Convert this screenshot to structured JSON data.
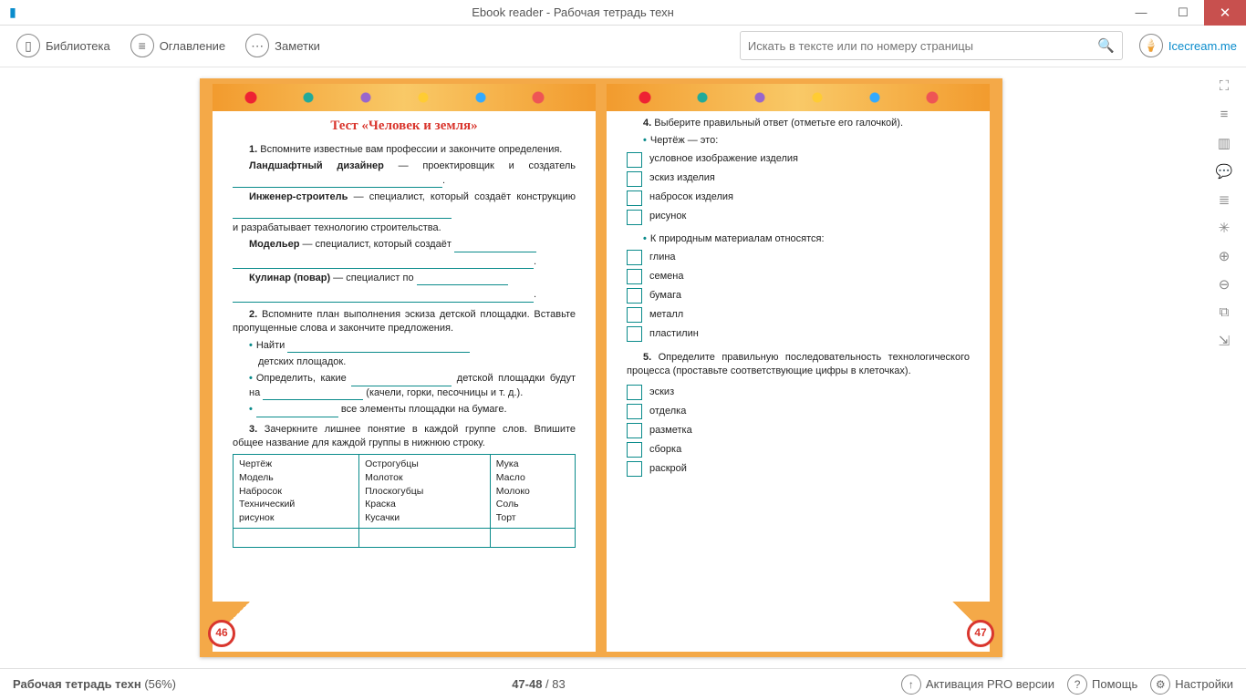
{
  "titlebar": {
    "title": "Ebook reader - Рабочая тетрадь техн"
  },
  "toolbar": {
    "library": "Библиотека",
    "toc": "Оглавление",
    "notes": "Заметки",
    "search_placeholder": "Искать в тексте или по номеру страницы",
    "brand": "Icecream.me"
  },
  "left": {
    "num": "46",
    "title": "Тест «Человек и земля»",
    "q1_a": "1.",
    "q1_b": " Вспомните известные вам профессии и закончите определения.",
    "q1_l1a": "Ландшафтный дизайнер",
    "q1_l1b": " — проектировщик и созда­тель ",
    "q1_l2a": "Инженер-строитель",
    "q1_l2b": " — специалист, который создаёт конструкцию ",
    "q1_l2c": "и разрабатывает технологию строительства.",
    "q1_l3a": "Модельер",
    "q1_l3b": " — специалист, который создаёт ",
    "q1_l4a": "Кулинар (повар)",
    "q1_l4b": " — специалист по ",
    "q2_a": "2.",
    "q2_b": " Вспомните план выполнения эскиза детской пло­щадки. Вставьте пропущенные слова и закончите пред­ложения.",
    "q2_li1a": "Найти ",
    "q2_li1b": " детских площадок.",
    "q2_li2a": "Определить, какие ",
    "q2_li2b": " детской площадки будут на ",
    "q2_li2c": " (качели, горки, песочницы и т. д.).",
    "q2_li3": " все элементы площадки на бумаге.",
    "q3_a": "3.",
    "q3_b": " Зачеркните лишнее понятие в каждой группе слов. Впишите общее название для каждой группы в нижнюю строку.",
    "table": {
      "c1": [
        "Чертёж",
        "Модель",
        "Набросок",
        "Технический",
        "рисунок"
      ],
      "c2": [
        "Острогубцы",
        "Молоток",
        "Плоскогубцы",
        "Краска",
        "Кусачки"
      ],
      "c3": [
        "Мука",
        "Масло",
        "Молоко",
        "Соль",
        "Торт"
      ]
    }
  },
  "right": {
    "num": "47",
    "q4_a": "4.",
    "q4_b": " Выберите правильный ответ (отметьте его галочкой).",
    "q4_h1": "Чертёж — это:",
    "q4_opts1": [
      "условное изображение изделия",
      "эскиз изделия",
      "набросок изделия",
      "рисунок"
    ],
    "q4_h2": "К природным материалам относятся:",
    "q4_opts2": [
      "глина",
      "семена",
      "бумага",
      "металл",
      "пластилин"
    ],
    "q5_a": "5.",
    "q5_b": " Определите правильную последовательность тех­нологического процесса (проставьте соответствующие цифры в клеточках).",
    "q5_opts": [
      "эскиз",
      "отделка",
      "разметка",
      "сборка",
      "раскрой"
    ]
  },
  "status": {
    "book": "Рабочая тетрадь техн",
    "pct": "(56%)",
    "pages": "47-48",
    "total": " / 83",
    "pro": "Активация PRO версии",
    "help": "Помощь",
    "settings": "Настройки"
  }
}
